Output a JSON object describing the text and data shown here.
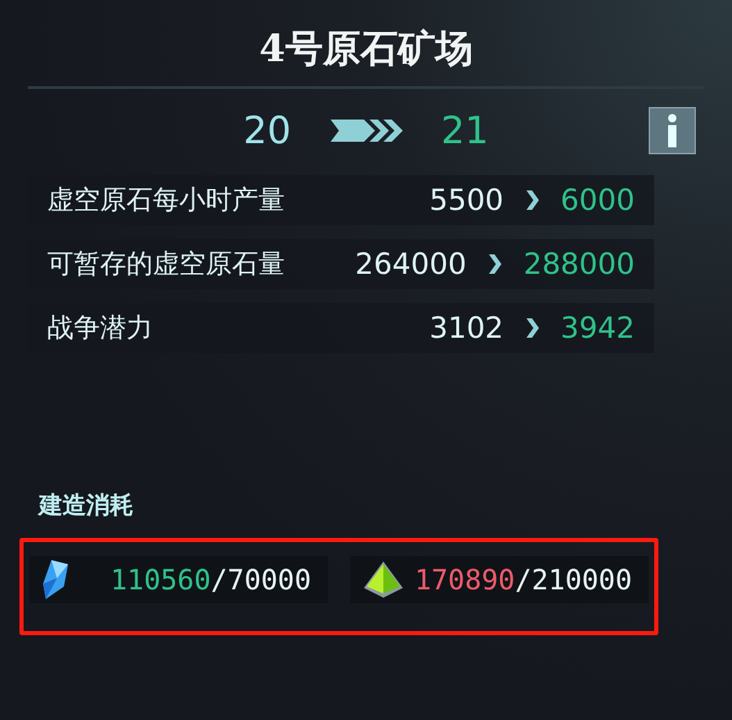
{
  "title": "4号原石矿场",
  "level": {
    "current": "20",
    "next": "21"
  },
  "stats": [
    {
      "label": "虚空原石每小时产量",
      "current": "5500",
      "next": "6000"
    },
    {
      "label": "可暂存的虚空原石量",
      "current": "264000",
      "next": "288000"
    },
    {
      "label": "战争潜力",
      "current": "3102",
      "next": "3942"
    }
  ],
  "costs_title": "建造消耗",
  "costs_highlighted": true,
  "costs": [
    {
      "kind": "crystal",
      "have": "110560",
      "need": "/70000",
      "sufficient": true
    },
    {
      "kind": "pyramid",
      "have": "170890",
      "need": "/210000",
      "sufficient": false
    }
  ]
}
